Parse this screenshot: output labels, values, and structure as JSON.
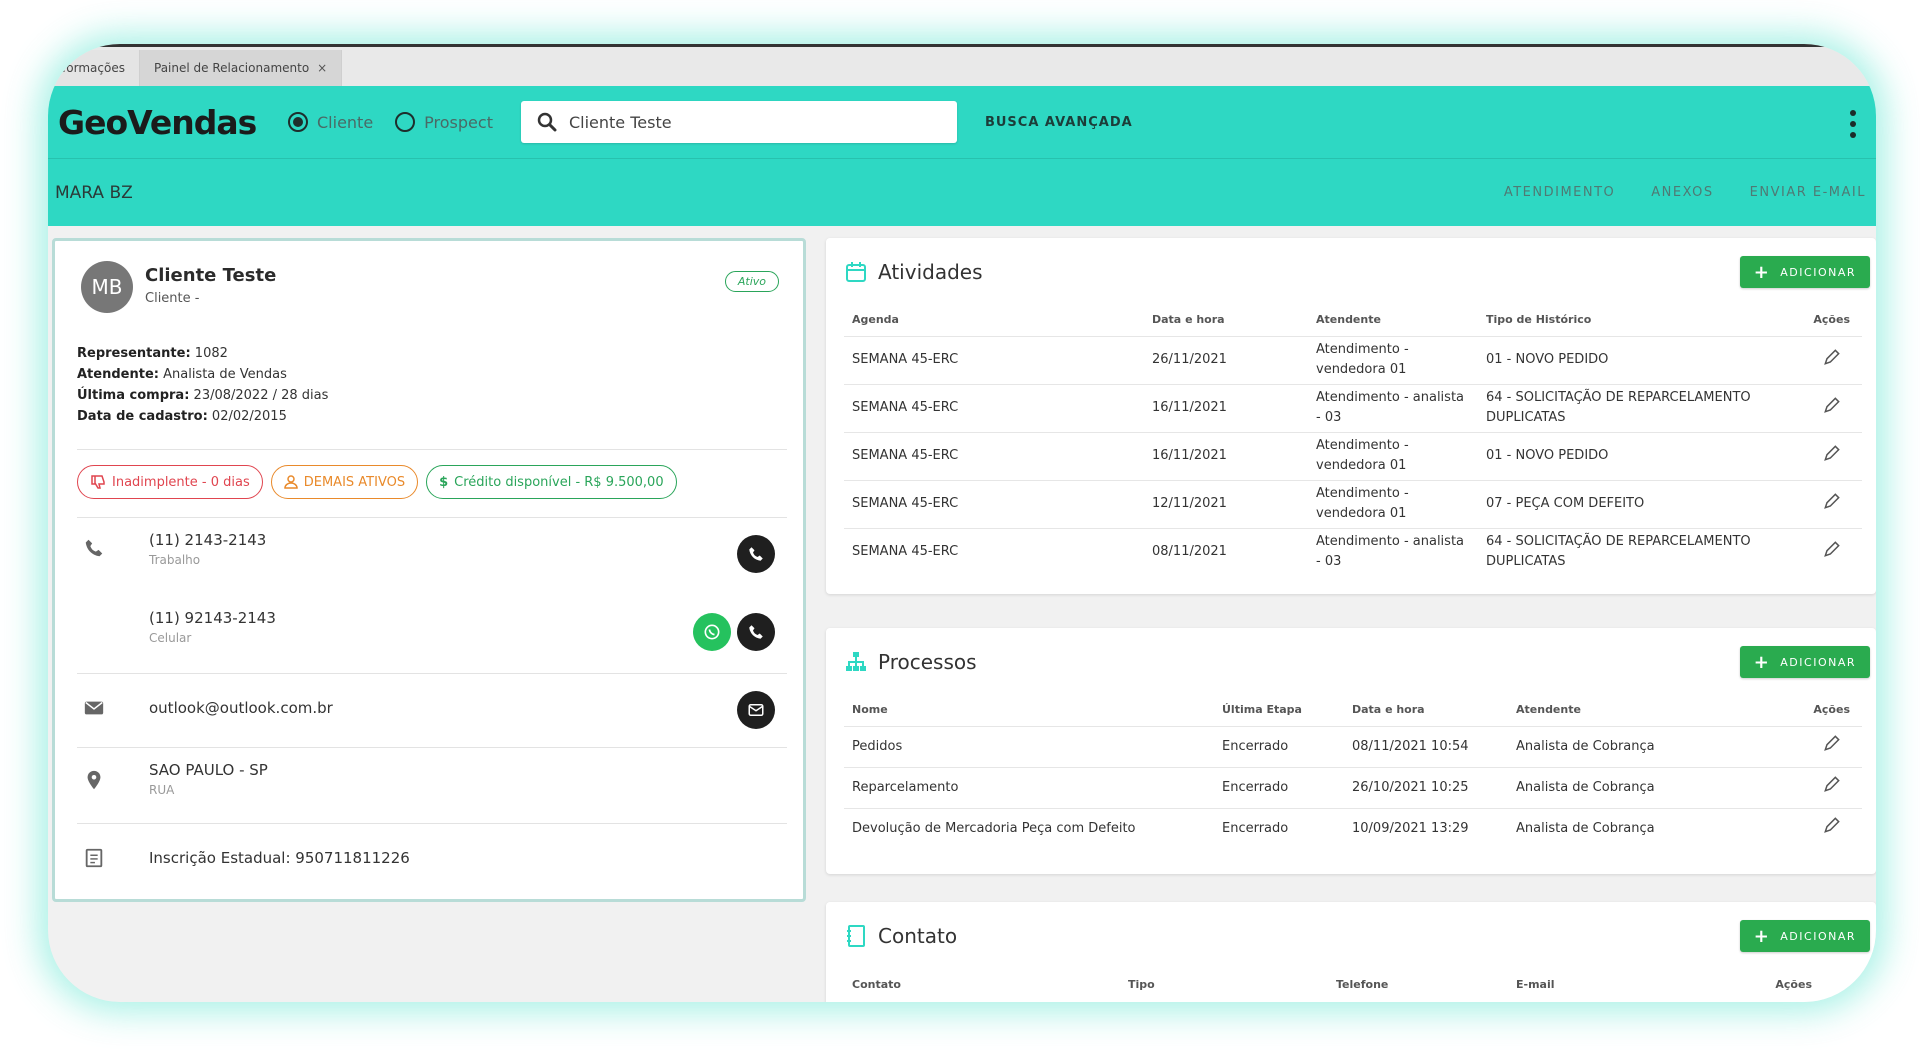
{
  "tabs": [
    {
      "label": "Informações"
    },
    {
      "label": "Painel de Relacionamento",
      "close": "×"
    }
  ],
  "topbar": {
    "logo": "GeoVendas",
    "radio_cliente": "Cliente",
    "radio_prospect": "Prospect",
    "search_value": "Cliente Teste",
    "advanced_search": "BUSCA AVANÇADA"
  },
  "subbar": {
    "name": "MARA BZ",
    "actions": [
      "ATENDIMENTO",
      "ANEXOS",
      "ENVIAR E-MAIL"
    ]
  },
  "client": {
    "initials": "MB",
    "name": "Cliente Teste",
    "type": "Cliente -",
    "status": "Ativo",
    "info": [
      {
        "label": "Representante:",
        "value": "1082"
      },
      {
        "label": "Atendente:",
        "value": "Analista de Vendas"
      },
      {
        "label": "Última compra:",
        "value": "23/08/2022 / 28 dias"
      },
      {
        "label": "Data de cadastro:",
        "value": "02/02/2015"
      }
    ],
    "chips": {
      "inadimplente": "Inadimplente - 0 dias",
      "demais": "DEMAIS ATIVOS",
      "credito": "Crédito disponível - R$ 9.500,00"
    },
    "phone1": {
      "number": "(11) 2143-2143",
      "label": "Trabalho"
    },
    "phone2": {
      "number": "(11) 92143-2143",
      "label": "Celular"
    },
    "email": "outlook@outlook.com.br",
    "address": {
      "city": "SAO PAULO - SP",
      "street": "RUA"
    },
    "ie": "Inscrição Estadual: 950711811226"
  },
  "atividades": {
    "title": "Atividades",
    "add": "ADICIONAR",
    "headers": [
      "Agenda",
      "Data e hora",
      "Atendente",
      "Tipo de Histórico",
      "Ações"
    ],
    "rows": [
      {
        "agenda": "SEMANA 45-ERC",
        "data": "26/11/2021",
        "atendente": "Atendimento - vendedora 01",
        "tipo": "01 - NOVO PEDIDO"
      },
      {
        "agenda": "SEMANA 45-ERC",
        "data": "16/11/2021",
        "atendente": "Atendimento - analista - 03",
        "tipo": "64 - SOLICITAÇÃO DE REPARCELAMENTO DUPLICATAS"
      },
      {
        "agenda": "SEMANA 45-ERC",
        "data": "16/11/2021",
        "atendente": "Atendimento - vendedora 01",
        "tipo": "01 - NOVO PEDIDO"
      },
      {
        "agenda": "SEMANA 45-ERC",
        "data": "12/11/2021",
        "atendente": "Atendimento - vendedora 01",
        "tipo": "07 - PEÇA COM DEFEITO"
      },
      {
        "agenda": "SEMANA 45-ERC",
        "data": "08/11/2021",
        "atendente": "Atendimento - analista - 03",
        "tipo": "64 - SOLICITAÇÃO DE REPARCELAMENTO DUPLICATAS"
      }
    ]
  },
  "processos": {
    "title": "Processos",
    "add": "ADICIONAR",
    "headers": [
      "Nome",
      "Última Etapa",
      "Data e hora",
      "Atendente",
      "Ações"
    ],
    "rows": [
      {
        "nome": "Pedidos",
        "etapa": "Encerrado",
        "data": "08/11/2021 10:54",
        "atendente": "Analista de Cobrança"
      },
      {
        "nome": "Reparcelamento",
        "etapa": "Encerrado",
        "data": "26/10/2021 10:25",
        "atendente": "Analista de Cobrança"
      },
      {
        "nome": "Devolução de Mercadoria Peça com Defeito",
        "etapa": "Encerrado",
        "data": "10/09/2021 13:29",
        "atendente": "Analista de Cobrança"
      }
    ]
  },
  "contato": {
    "title": "Contato",
    "add": "ADICIONAR",
    "headers": [
      "Contato",
      "Tipo",
      "Telefone",
      "E-mail",
      "Ações"
    ]
  },
  "colors": {
    "brand": "#2ed8c3",
    "add_button": "#2aab4f",
    "danger": "#e0454f",
    "warning": "#e98a2b",
    "success": "#2aa55a"
  },
  "icons": [
    "search-icon",
    "kebab-menu-icon",
    "calendar-icon",
    "sitemap-icon",
    "contact-book-icon",
    "phone-icon",
    "whatsapp-icon",
    "mail-icon",
    "location-pin-icon",
    "document-icon",
    "pencil-icon",
    "thumbs-down-icon",
    "person-icon",
    "dollar-icon",
    "plus-icon"
  ]
}
